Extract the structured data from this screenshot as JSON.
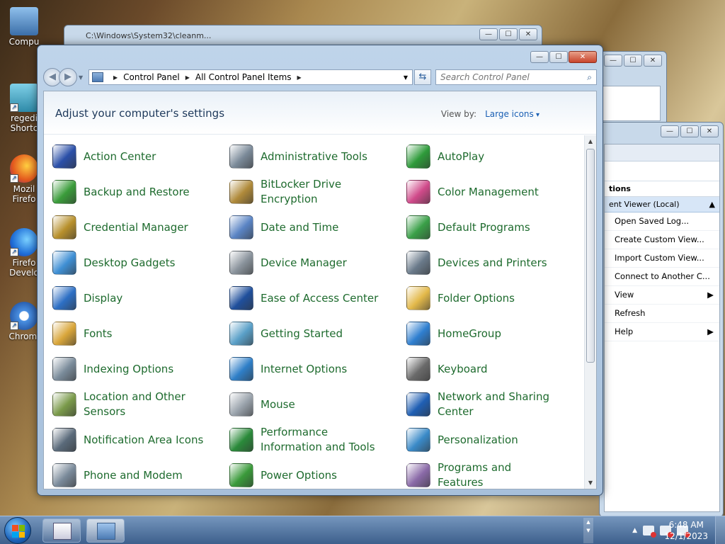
{
  "desktop": {
    "icons": [
      {
        "label": "Compu",
        "color": "#4a7fc1"
      },
      {
        "label": "regedi Shortc",
        "color": "#3ba5c8"
      },
      {
        "label": "Mozil Firefo",
        "color": "#e36b1d"
      },
      {
        "label": "Firefo Develo",
        "color": "#2a7ad8"
      },
      {
        "label": "Chromi",
        "color": "#4a90e2"
      }
    ]
  },
  "bg_window_1": {
    "title": "C:\\Windows\\System32\\cleanm..."
  },
  "event_viewer": {
    "actions_header": "tions",
    "selected": "ent Viewer (Local)",
    "actions": [
      {
        "label": "Open Saved Log...",
        "sub": ""
      },
      {
        "label": "Create Custom View...",
        "sub": ""
      },
      {
        "label": "Import Custom View...",
        "sub": ""
      },
      {
        "label": "Connect to Another C...",
        "sub": ""
      },
      {
        "label": "View",
        "sub": "▶"
      },
      {
        "label": "Refresh",
        "sub": ""
      },
      {
        "label": "Help",
        "sub": "▶"
      }
    ]
  },
  "control_panel": {
    "window_buttons": {
      "minimize": "—",
      "maximize": "☐",
      "close": "✕"
    },
    "nav": {
      "back": "◀",
      "forward": "▶"
    },
    "breadcrumb": [
      "Control Panel",
      "All Control Panel Items"
    ],
    "search_placeholder": "Search Control Panel",
    "header_title": "Adjust your computer's settings",
    "view_by_label": "View by:",
    "view_by_value": "Large icons",
    "items": [
      {
        "label": "Action Center",
        "icon": "flag-icon",
        "color": "#2b4fa8"
      },
      {
        "label": "Administrative Tools",
        "icon": "admin-tools-icon",
        "color": "#7b8a99"
      },
      {
        "label": "AutoPlay",
        "icon": "autoplay-icon",
        "color": "#2e9b3a"
      },
      {
        "label": "Backup and Restore",
        "icon": "backup-icon",
        "color": "#3a9c3a"
      },
      {
        "label": "BitLocker Drive Encryption",
        "icon": "bitlocker-icon",
        "color": "#b08a3a"
      },
      {
        "label": "Color Management",
        "icon": "color-management-icon",
        "color": "#d04a8a"
      },
      {
        "label": "Credential Manager",
        "icon": "credential-icon",
        "color": "#b8902c"
      },
      {
        "label": "Date and Time",
        "icon": "clock-icon",
        "color": "#5a84c4"
      },
      {
        "label": "Default Programs",
        "icon": "default-programs-icon",
        "color": "#3aa048"
      },
      {
        "label": "Desktop Gadgets",
        "icon": "gadgets-icon",
        "color": "#3f8fd4"
      },
      {
        "label": "Device Manager",
        "icon": "device-manager-icon",
        "color": "#8a939c"
      },
      {
        "label": "Devices and Printers",
        "icon": "printer-icon",
        "color": "#6a7a8a"
      },
      {
        "label": "Display",
        "icon": "display-icon",
        "color": "#2d6fc4"
      },
      {
        "label": "Ease of Access Center",
        "icon": "ease-of-access-icon",
        "color": "#1f4f9c"
      },
      {
        "label": "Folder Options",
        "icon": "folder-icon",
        "color": "#e3b94a"
      },
      {
        "label": "Fonts",
        "icon": "fonts-icon",
        "color": "#d9a63a"
      },
      {
        "label": "Getting Started",
        "icon": "getting-started-icon",
        "color": "#5aa0c8"
      },
      {
        "label": "HomeGroup",
        "icon": "homegroup-icon",
        "color": "#2f7fd0"
      },
      {
        "label": "Indexing Options",
        "icon": "indexing-icon",
        "color": "#7a8b9a"
      },
      {
        "label": "Internet Options",
        "icon": "internet-options-icon",
        "color": "#2f7fc8"
      },
      {
        "label": "Keyboard",
        "icon": "keyboard-icon",
        "color": "#6a6a6a"
      },
      {
        "label": "Location and Other Sensors",
        "icon": "sensors-icon",
        "color": "#7a9a4a"
      },
      {
        "label": "Mouse",
        "icon": "mouse-icon",
        "color": "#9aa3ac"
      },
      {
        "label": "Network and Sharing Center",
        "icon": "network-icon",
        "color": "#1f5fb4"
      },
      {
        "label": "Notification Area Icons",
        "icon": "notification-icon",
        "color": "#5a6a7a"
      },
      {
        "label": "Performance Information and Tools",
        "icon": "performance-icon",
        "color": "#2a8a3a"
      },
      {
        "label": "Personalization",
        "icon": "personalization-icon",
        "color": "#3a8ac8"
      },
      {
        "label": "Phone and Modem",
        "icon": "phone-icon",
        "color": "#7a8a9a"
      },
      {
        "label": "Power Options",
        "icon": "power-icon",
        "color": "#3a9a3a"
      },
      {
        "label": "Programs and Features",
        "icon": "programs-icon",
        "color": "#8a6aa8"
      }
    ]
  },
  "taskbar": {
    "time": "6:48 AM",
    "date": "12/1/2023",
    "tray_chevron": "▲"
  }
}
